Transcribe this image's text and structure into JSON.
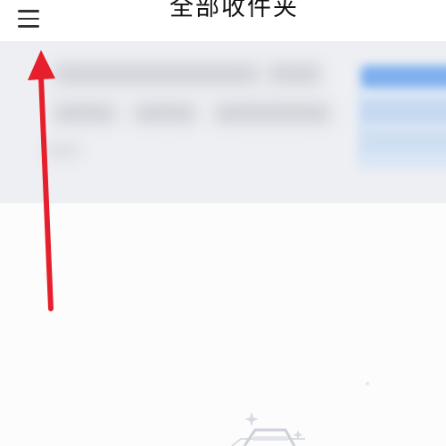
{
  "header": {
    "title": "全部收件夹",
    "menu_icon": "hamburger-menu-icon"
  },
  "annotation": {
    "arrow_color": "#e5202c"
  },
  "colors": {
    "banner_bg": "#eeeff3",
    "card_accent": "#7fb0ee"
  }
}
